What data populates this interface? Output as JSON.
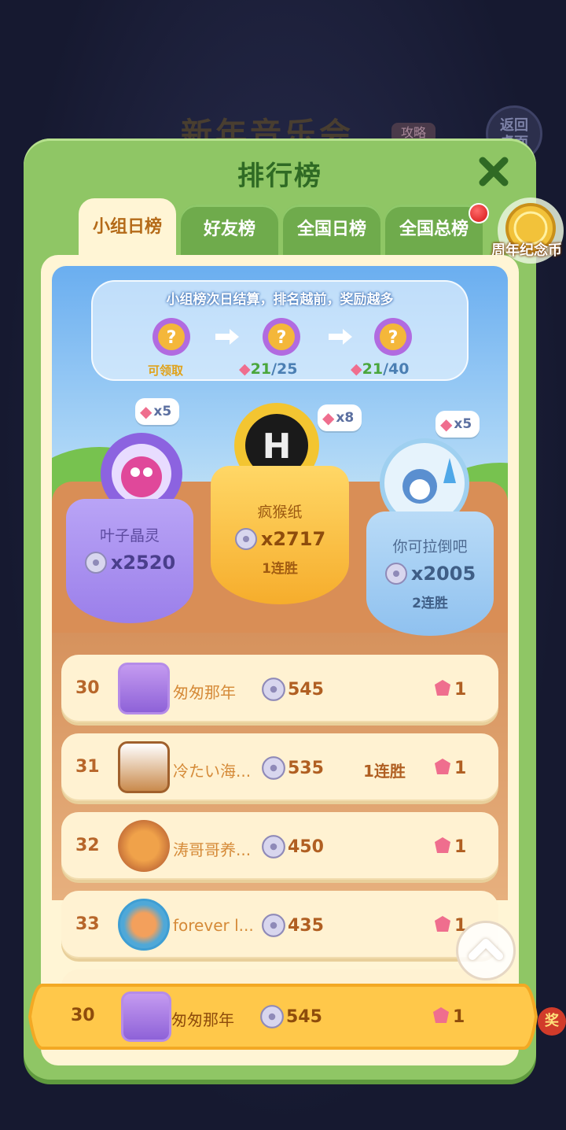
{
  "background": {
    "event_title": "新年音乐会",
    "event_tag": "攻略",
    "back_button": "返回\n桌面"
  },
  "panel": {
    "title": "排行榜",
    "tabs": [
      {
        "label": "小组日榜",
        "active": true
      },
      {
        "label": "好友榜",
        "active": false
      },
      {
        "label": "全国日榜",
        "active": false
      },
      {
        "label": "全国总榜",
        "active": false
      }
    ],
    "coin_label": "周年纪念币"
  },
  "rewards": {
    "notice": "小组榜次日结算，排名越前，奖励越多",
    "claimable_label": "可领取",
    "milestones": [
      {
        "current": "21",
        "total": "/25"
      },
      {
        "current": "21",
        "total": "/40"
      }
    ]
  },
  "podium": {
    "first": {
      "name": "疯猴纸",
      "score": "x2717",
      "streak": "1连胜",
      "reward": "x8"
    },
    "second": {
      "name": "叶子晶灵",
      "score": "x2520",
      "reward": "x5"
    },
    "third": {
      "name": "你可拉倒吧",
      "score": "x2005",
      "streak": "2连胜",
      "reward": "x5"
    }
  },
  "rows": [
    {
      "rank": "30",
      "name": "匆匆那年",
      "score": "545",
      "streak": "",
      "gems": "1"
    },
    {
      "rank": "31",
      "name": "冷たい海...",
      "score": "535",
      "streak": "1连胜",
      "gems": "1"
    },
    {
      "rank": "32",
      "name": "涛哥哥养...",
      "score": "450",
      "streak": "",
      "gems": "1"
    },
    {
      "rank": "33",
      "name": "forever l...",
      "score": "435",
      "streak": "",
      "gems": "1"
    }
  ],
  "self_row": {
    "rank": "30",
    "name": "匆匆那年",
    "score": "545",
    "gems": "1"
  },
  "side_tag": "奖",
  "colors": {
    "panel_green": "#8fc665",
    "cream": "#fff5d5",
    "gold": "#ffc84a",
    "purple": "#a68cf0",
    "blue": "#9cc8f4"
  }
}
